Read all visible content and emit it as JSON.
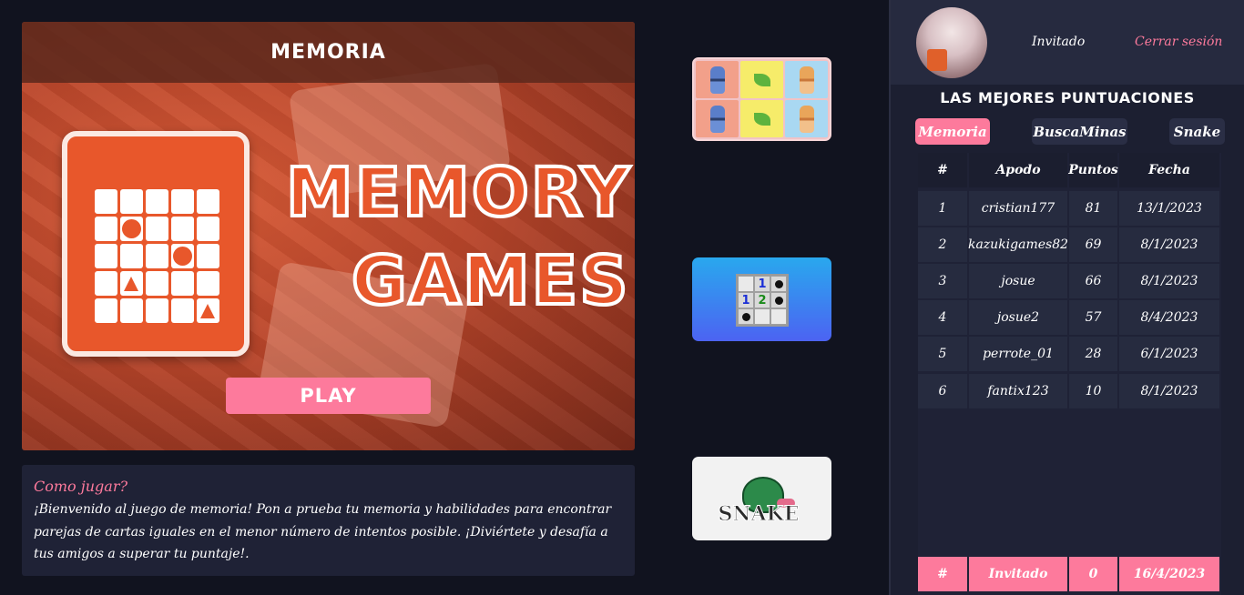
{
  "game": {
    "title": "MEMORIA",
    "logo_line1": "MEMORY",
    "logo_line2": "GAMES",
    "play_label": "PLAY"
  },
  "info": {
    "title": "Como jugar?",
    "text": "¡Bienvenido al juego de memoria! Pon a prueba tu memoria y habilidades para encontrar parejas de cartas iguales en el menor número de intentos posible. ¡Diviértete y desafía a tus amigos a superar tu puntaje!."
  },
  "thumbnails": {
    "mines_numbers": [
      "1",
      "1",
      "2"
    ],
    "snake_word": "SNAKE"
  },
  "user": {
    "name": "Invitado",
    "logout_label": "Cerrar sesión"
  },
  "scores": {
    "title": "LAS MEJORES PUNTUACIONES",
    "tabs": [
      "Memoria",
      "BuscaMinas",
      "Snake"
    ],
    "active_tab": "Memoria",
    "headers": [
      "#",
      "Apodo",
      "Puntos",
      "Fecha"
    ],
    "rows": [
      {
        "rank": "1",
        "nick": "cristian177",
        "points": "81",
        "date": "13/1/2023"
      },
      {
        "rank": "2",
        "nick": "kazukigames82",
        "points": "69",
        "date": "8/1/2023"
      },
      {
        "rank": "3",
        "nick": "josue",
        "points": "66",
        "date": "8/1/2023"
      },
      {
        "rank": "4",
        "nick": "josue2",
        "points": "57",
        "date": "8/4/2023"
      },
      {
        "rank": "5",
        "nick": "perrote_01",
        "points": "28",
        "date": "6/1/2023"
      },
      {
        "rank": "6",
        "nick": "fantix123",
        "points": "10",
        "date": "8/1/2023"
      }
    ],
    "current_user": {
      "rank": "#",
      "nick": "Invitado",
      "points": "0",
      "date": "16/4/2023"
    }
  },
  "colors": {
    "accent": "#fd7a9c",
    "background": "#11131f",
    "panel": "#1f2236",
    "brand_orange": "#e8572b"
  }
}
